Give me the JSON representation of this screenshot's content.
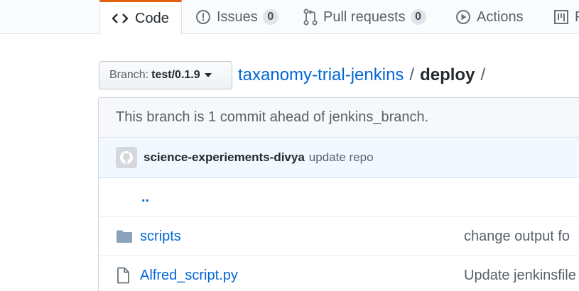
{
  "tabs": [
    {
      "label": "Code",
      "icon": "code-icon",
      "selected": true
    },
    {
      "label": "Issues",
      "icon": "issue-opened-icon",
      "count": "0"
    },
    {
      "label": "Pull requests",
      "icon": "git-pull-request-icon",
      "count": "0"
    },
    {
      "label": "Actions",
      "icon": "play-icon"
    },
    {
      "label": "P",
      "icon": "project-icon"
    }
  ],
  "branch": {
    "prefix": "Branch:",
    "name": "test/0.1.9"
  },
  "breadcrumb": {
    "repo": "taxanomy-trial-jenkins",
    "sep1": "/",
    "dir": "deploy",
    "sep2": "/"
  },
  "ahead_notice": "This branch is 1 commit ahead of jenkins_branch.",
  "latest_commit": {
    "author": "science-experiements-divya",
    "message": "update repo"
  },
  "files": {
    "parent": "..",
    "rows": [
      {
        "type": "directory",
        "icon": "folder-icon",
        "name": "scripts",
        "commit_message": "change output fo"
      },
      {
        "type": "file",
        "icon": "file-icon",
        "name": "Alfred_script.py",
        "commit_message": "Update jenkinsfile"
      }
    ]
  },
  "colors": {
    "link": "#0366d6",
    "selected_tab_accent": "#e36209",
    "commit_bg": "#f1f8ff"
  }
}
